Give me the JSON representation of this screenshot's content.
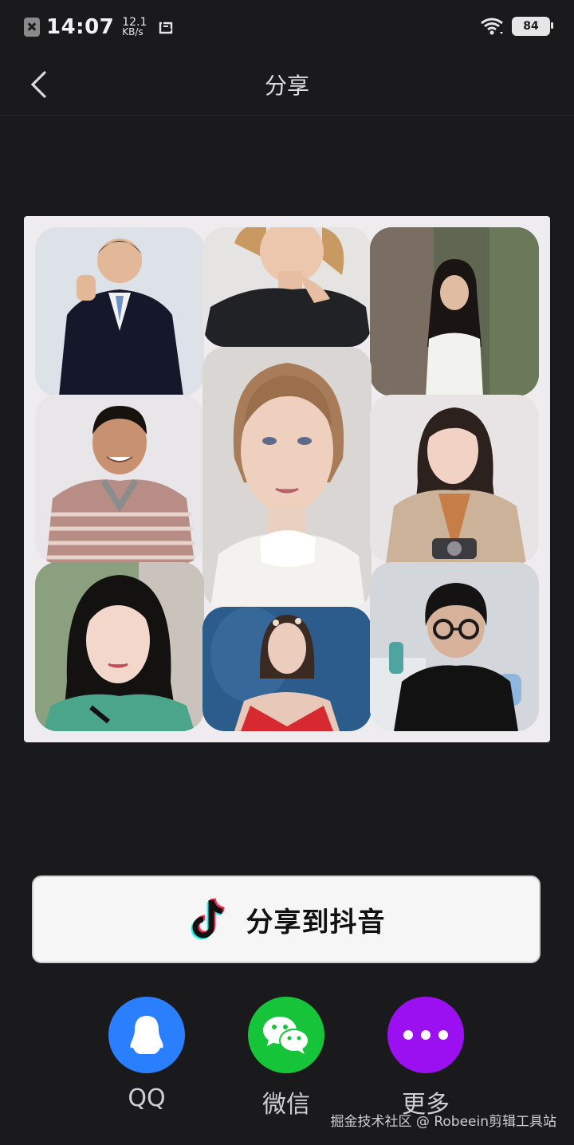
{
  "status_bar": {
    "time": "14:07",
    "net_speed_value": "12.1",
    "net_speed_unit": "KB/s",
    "battery": "84",
    "icons": [
      "sim-off-icon",
      "screenshot-icon",
      "wifi-icon",
      "battery-icon"
    ]
  },
  "header": {
    "back_icon": "chevron-left-icon",
    "title": "分享"
  },
  "preview": {
    "grid": "3x3 collage"
  },
  "douyin_button": {
    "icon": "douyin-logo-icon",
    "label": "分享到抖音"
  },
  "share_targets": [
    {
      "label": "QQ",
      "icon": "qq-penguin-icon",
      "color": "#2a7fff"
    },
    {
      "label": "微信",
      "icon": "wechat-icon",
      "color": "#16c43a"
    },
    {
      "label": "更多",
      "icon": "more-dots-icon",
      "color": "#9b10f1"
    }
  ],
  "watermark": "掘金技术社区 @ Robeein剪辑工具站"
}
